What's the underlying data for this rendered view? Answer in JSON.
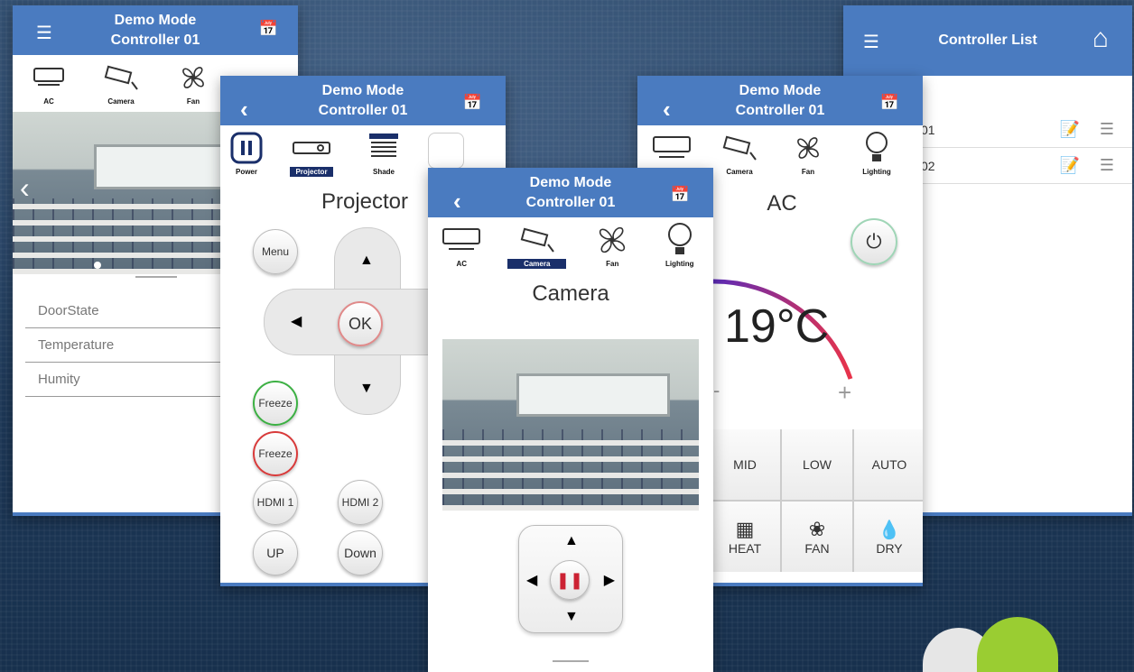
{
  "screens": {
    "sensors": {
      "title_line1": "Demo Mode",
      "title_line2": "Controller 01",
      "tabs": [
        "AC",
        "Camera",
        "Fan"
      ],
      "rows": [
        "DoorState",
        "Temperature",
        "Humity"
      ]
    },
    "projector": {
      "title_line1": "Demo Mode",
      "title_line2": "Controller 01",
      "tabs": [
        "Power",
        "Projector",
        "Shade"
      ],
      "heading": "Projector",
      "menu_label": "Menu",
      "ok_label": "OK",
      "freeze_green": "Freeze",
      "freeze_red": "Freeze",
      "hdmi1": "HDMI 1",
      "hdmi2": "HDMI 2",
      "up": "UP",
      "down": "Down"
    },
    "camera": {
      "title_line1": "Demo Mode",
      "title_line2": "Controller 01",
      "tabs": [
        "AC",
        "Camera",
        "Fan",
        "Lighting"
      ],
      "heading": "Camera"
    },
    "ac": {
      "title_line1": "Demo Mode",
      "title_line2": "Controller 01",
      "tabs": [
        "Camera",
        "Fan",
        "Lighting"
      ],
      "heading": "AC",
      "temperature": "19°C",
      "plus": "+",
      "minus": "-",
      "modes_row1": [
        "MID",
        "LOW",
        "AUTO"
      ],
      "modes_row2": [
        "HEAT",
        "FAN",
        "DRY"
      ]
    },
    "list": {
      "title": "Controller List",
      "rows": [
        "01",
        "02"
      ]
    }
  },
  "colors": {
    "header_blue": "#4a7bc0",
    "selected_tab": "#1a2f6a",
    "freeze_green": "#3cb043",
    "freeze_red": "#d83a3a",
    "pause_red": "#cc2233"
  }
}
